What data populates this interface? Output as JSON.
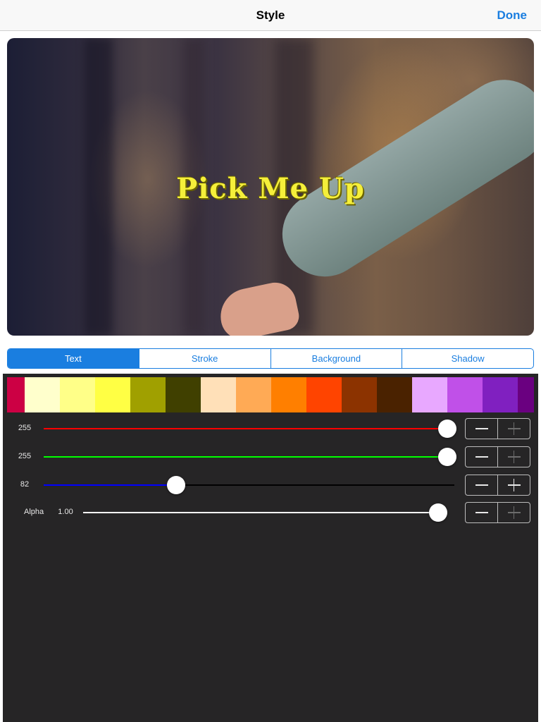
{
  "nav": {
    "title": "Style",
    "done_label": "Done"
  },
  "preview": {
    "caption": "Pick Me Up",
    "caption_color": "#f5ef3a"
  },
  "tabs": [
    {
      "label": "Text",
      "active": true
    },
    {
      "label": "Stroke",
      "active": false
    },
    {
      "label": "Background",
      "active": false
    },
    {
      "label": "Shadow",
      "active": false
    }
  ],
  "palette": [
    "#cc0044",
    "#ffffcc",
    "#ffff88",
    "#ffff44",
    "#a0a000",
    "#404000",
    "#ffe0b8",
    "#ffaa55",
    "#ff7f00",
    "#ff4400",
    "#8c3300",
    "#4a2200",
    "#e8a8ff",
    "#c050e8",
    "#8020c0",
    "#6a0080"
  ],
  "sliders": [
    {
      "channel": "red",
      "value": "255",
      "fraction": 1.0,
      "color": "#ff0000",
      "minus_enabled": true,
      "plus_enabled": false
    },
    {
      "channel": "green",
      "value": "255",
      "fraction": 1.0,
      "color": "#00ff00",
      "minus_enabled": true,
      "plus_enabled": false
    },
    {
      "channel": "blue",
      "value": "82",
      "fraction": 0.322,
      "color": "#0000ff",
      "minus_enabled": true,
      "plus_enabled": true
    },
    {
      "channel": "alpha",
      "label": "Alpha",
      "value": "1.00",
      "fraction": 1.0,
      "color": "#ffffff",
      "minus_enabled": true,
      "plus_enabled": false
    }
  ],
  "icons": {
    "minus": "minus-icon",
    "plus": "plus-icon"
  }
}
